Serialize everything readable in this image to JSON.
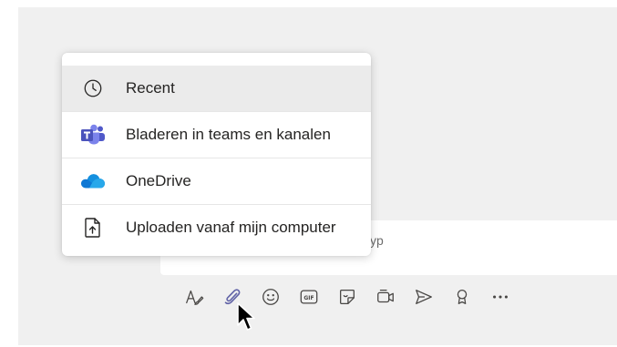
{
  "attach_menu": {
    "items": [
      {
        "label": "Recent",
        "icon": "clock-icon"
      },
      {
        "label": "Bladeren in teams en kanalen",
        "icon": "teams-icon"
      },
      {
        "label": "OneDrive",
        "icon": "onedrive-icon"
      },
      {
        "label": "Uploaden vanaf mijn computer",
        "icon": "upload-file-icon"
      }
    ],
    "selected_index": 0
  },
  "compose": {
    "placeholder_fragment": "yp"
  },
  "toolbar": {
    "buttons": [
      "format-icon",
      "attach-icon",
      "emoji-icon",
      "gif-icon",
      "sticker-icon",
      "meet-now-icon",
      "send-icon",
      "praise-icon",
      "more-options-icon"
    ],
    "active": "attach-icon"
  },
  "colors": {
    "accent": "#6264a7",
    "teams_purple": "#5059c9",
    "onedrive_blue": "#0f78d4",
    "icon_gray": "#484644",
    "selected_bg": "#ebebeb"
  }
}
